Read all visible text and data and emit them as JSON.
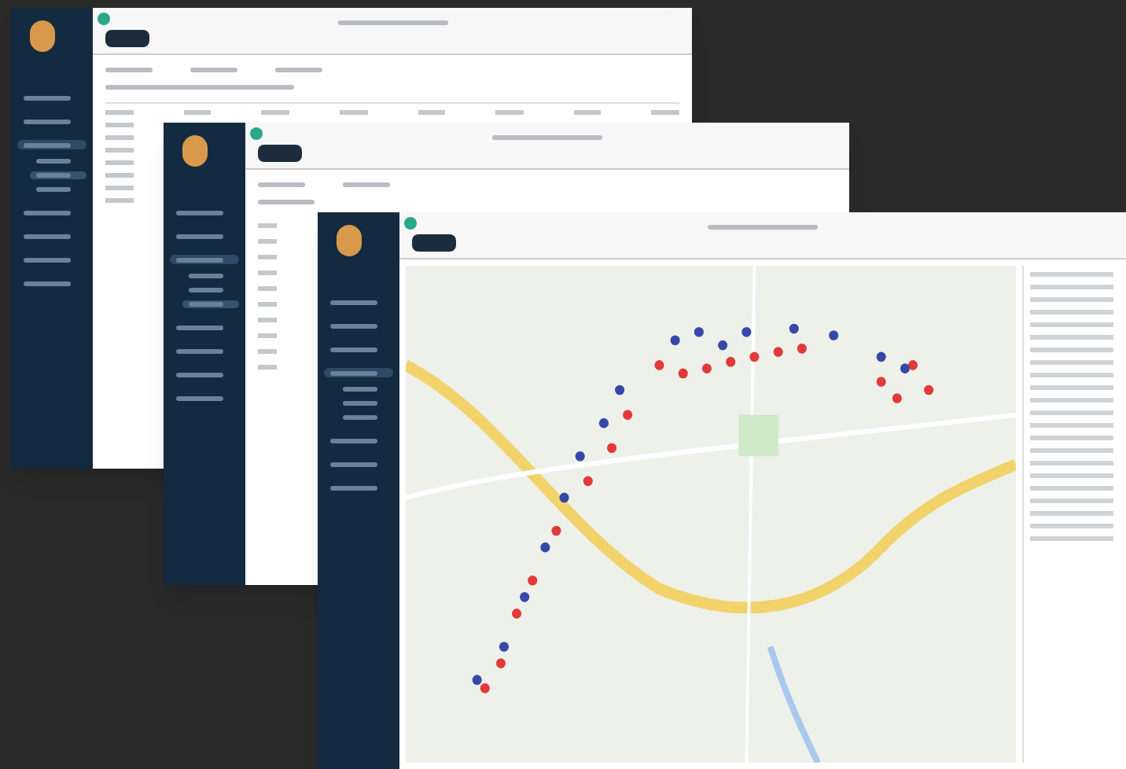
{
  "windows": [
    {
      "kind": "table",
      "sidebar": {
        "items": [
          {
            "selected": false
          },
          {
            "selected": false
          },
          {
            "selected": true,
            "expanded": true,
            "children": [
              {
                "selected": false
              },
              {
                "selected": true
              },
              {
                "selected": false
              }
            ]
          },
          {
            "selected": false
          },
          {
            "selected": false
          },
          {
            "selected": false
          },
          {
            "selected": false
          }
        ]
      }
    },
    {
      "kind": "list",
      "sidebar": {
        "items": [
          {
            "selected": false
          },
          {
            "selected": false
          },
          {
            "selected": true,
            "expanded": true,
            "children": [
              {
                "selected": false
              },
              {
                "selected": false
              },
              {
                "selected": true
              }
            ]
          },
          {
            "selected": false
          },
          {
            "selected": false
          },
          {
            "selected": false
          },
          {
            "selected": false
          }
        ]
      }
    },
    {
      "kind": "map",
      "sidebar": {
        "items": [
          {
            "selected": false
          },
          {
            "selected": false
          },
          {
            "selected": false
          },
          {
            "selected": true,
            "expanded": true,
            "children": [
              {
                "selected": false
              },
              {
                "selected": false
              },
              {
                "selected": false
              }
            ]
          },
          {
            "selected": false
          },
          {
            "selected": false
          },
          {
            "selected": false
          }
        ]
      }
    }
  ]
}
